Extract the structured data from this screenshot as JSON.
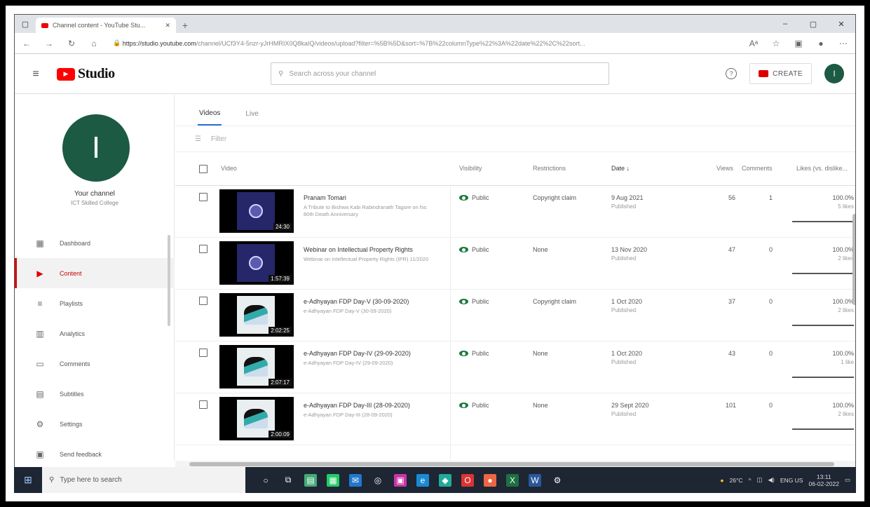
{
  "browser": {
    "tab_title": "Channel content - YouTube Stu...",
    "url_host": "https://studio.youtube.com",
    "url_rest": "/channel/UCf3Y4-5nzr-yJrHMRIX0Q8kaIQ/videos/upload?filter=%5B%5D&sort=%7B%22columnType%22%3A%22date%22%2C%22sort..."
  },
  "header": {
    "logo_text": "Studio",
    "search_placeholder": "Search across your channel",
    "create_label": "CREATE",
    "avatar_letter": "I"
  },
  "sidebar": {
    "avatar_letter": "I",
    "channel_title": "Your channel",
    "channel_name": "ICT Skilled College",
    "items": [
      {
        "label": "Dashboard",
        "icon": "▦"
      },
      {
        "label": "Content",
        "icon": "▶"
      },
      {
        "label": "Playlists",
        "icon": "≡"
      },
      {
        "label": "Analytics",
        "icon": "▥"
      },
      {
        "label": "Comments",
        "icon": "▭"
      },
      {
        "label": "Subtitles",
        "icon": "▤"
      },
      {
        "label": "Settings",
        "icon": "⚙"
      },
      {
        "label": "Send feedback",
        "icon": "▣"
      }
    ]
  },
  "tabs": [
    "Videos",
    "Live"
  ],
  "filter_placeholder": "Filter",
  "columns": {
    "video": "Video",
    "visibility": "Visibility",
    "restrictions": "Restrictions",
    "date": "Date ↓",
    "views": "Views",
    "comments": "Comments",
    "likes": "Likes (vs. dislike..."
  },
  "rows": [
    {
      "title": "Pranam Tomari",
      "desc": "A Tribute to Bishwa Kabi Rabindranath Tagore on his 80th Death Anniversary",
      "duration": "24:30",
      "visibility": "Public",
      "restrictions": "Copyright claim",
      "date": "9 Aug 2021",
      "date_sub": "Published",
      "views": "56",
      "comments": "1",
      "likes": "100.0%",
      "likes_sub": "5 likes",
      "thumb": "seal"
    },
    {
      "title": "Webinar on Intellectual Property Rights",
      "desc": "Webinar on Intellectual Property Rights (IPR) 11/2020",
      "duration": "1:57:39",
      "visibility": "Public",
      "restrictions": "None",
      "date": "13 Nov 2020",
      "date_sub": "Published",
      "views": "47",
      "comments": "0",
      "likes": "100.0%",
      "likes_sub": "2 likes",
      "thumb": "seal"
    },
    {
      "title": "e-Adhyayan FDP Day-V (30-09-2020)",
      "desc": "e-Adhyayan FDP Day-V (30-09-2020)",
      "duration": "2:02:25",
      "visibility": "Public",
      "restrictions": "Copyright claim",
      "date": "1 Oct 2020",
      "date_sub": "Published",
      "views": "37",
      "comments": "0",
      "likes": "100.0%",
      "likes_sub": "2 likes",
      "thumb": "cap"
    },
    {
      "title": "e-Adhyayan FDP Day-IV (29-09-2020)",
      "desc": "e-Adhyayan FDP Day-IV (29-09-2020)",
      "duration": "2:07:17",
      "visibility": "Public",
      "restrictions": "None",
      "date": "1 Oct 2020",
      "date_sub": "Published",
      "views": "43",
      "comments": "0",
      "likes": "100.0%",
      "likes_sub": "1 like",
      "thumb": "cap"
    },
    {
      "title": "e-Adhyayan FDP Day-III (28-09-2020)",
      "desc": "e-Adhyayan FDP Day-III (28-09-2020)",
      "duration": "2:00:09",
      "visibility": "Public",
      "restrictions": "None",
      "date": "29 Sept 2020",
      "date_sub": "Published",
      "views": "101",
      "comments": "0",
      "likes": "100.0%",
      "likes_sub": "2 likes",
      "thumb": "cap"
    }
  ],
  "taskbar": {
    "search_placeholder": "Type here to search",
    "weather": "26°C",
    "lang": "ENG US",
    "time": "13:11",
    "date": "06-02-2022"
  },
  "colors": {
    "accent_red": "#ff0000",
    "avatar_green": "#1c5a43",
    "public_green": "#1c7a3c"
  }
}
